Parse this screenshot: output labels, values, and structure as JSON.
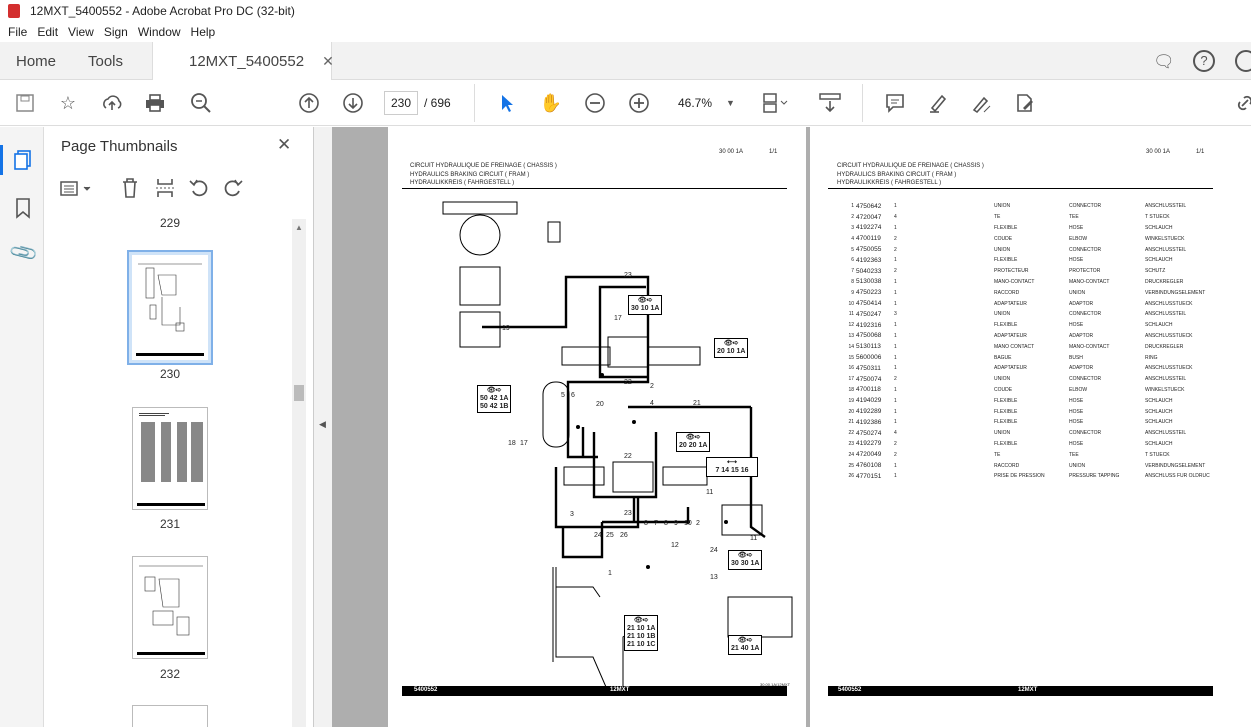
{
  "window": {
    "title": "12MXT_5400552 - Adobe Acrobat Pro DC (32-bit)"
  },
  "menu": [
    "File",
    "Edit",
    "View",
    "Sign",
    "Window",
    "Help"
  ],
  "tabs": {
    "home": "Home",
    "tools": "Tools",
    "document": "12MXT_5400552"
  },
  "toolbar": {
    "page_current": "230",
    "page_total": "/ 696",
    "zoom": "46.7%"
  },
  "sidebar": {
    "title": "Page Thumbnails",
    "thumbnails": [
      "229",
      "230",
      "231",
      "232"
    ]
  },
  "left_page": {
    "title_lines": [
      "CIRCUIT HYDRAULIQUE DE FREINAGE ( CHASSIS )",
      "HYDRAULICS BRAKING CIRCUIT ( FRAM )",
      "HYDRAULIKKREIS ( FAHRGESTELL )"
    ],
    "ref": "30  00  1A",
    "pageno": "1/1",
    "footer_left": "5400552",
    "footer_center": "12MXT",
    "drawing_code": "30.00.1A/12MXT",
    "refs": {
      "r1": "30 10 1A",
      "r2": "20 10 1A",
      "r3a": "50 42 1A",
      "r3b": "50 42 1B",
      "r4": "20 20 1A",
      "r5": "7  14 15 16",
      "r6": "30 30 1A",
      "r7a": "21 10 1A",
      "r7b": "21 10 1B",
      "r7c": "21 10 1C",
      "r8": "21 40 1A"
    },
    "callouts": [
      "23",
      "17",
      "19",
      "22",
      "2",
      "18",
      "17",
      "5",
      "4",
      "6",
      "20",
      "21",
      "22",
      "23",
      "3",
      "24",
      "25",
      "26",
      "1",
      "8",
      "7",
      "8",
      "9",
      "10",
      "2",
      "11",
      "12",
      "24",
      "13",
      "11"
    ]
  },
  "right_page": {
    "title_lines": [
      "CIRCUIT HYDRAULIQUE DE FREINAGE ( CHASSIS )",
      "HYDRAULICS BRAKING CIRCUIT ( FRAM )",
      "HYDRAULIKKREIS ( FAHRGESTELL )"
    ],
    "ref": "30  00  1A",
    "pageno": "1/1",
    "footer_left": "5400552",
    "footer_center": "12MXT",
    "parts": [
      [
        "1",
        "4750642",
        "1",
        "UNION",
        "CONNECTOR",
        "ANSCHLUSSTEIL"
      ],
      [
        "2",
        "4720047",
        "4",
        "TE",
        "TEE",
        "T STUECK"
      ],
      [
        "3",
        "4192274",
        "1",
        "FLEXIBLE",
        "HOSE",
        "SCHLAUCH"
      ],
      [
        "4",
        "4700119",
        "2",
        "COUDE",
        "ELBOW",
        "WINKELSTUECK"
      ],
      [
        "5",
        "4750055",
        "2",
        "UNION",
        "CONNECTOR",
        "ANSCHLUSSTEIL"
      ],
      [
        "6",
        "4192363",
        "1",
        "FLEXIBLE",
        "HOSE",
        "SCHLAUCH"
      ],
      [
        "7",
        "5040233",
        "2",
        "PROTECTEUR",
        "PROTECTOR",
        "SCHUTZ"
      ],
      [
        "8",
        "5130038",
        "1",
        "MANO-CONTACT",
        "MANO-CONTACT",
        "DRUCKREGLER"
      ],
      [
        "9",
        "4750223",
        "1",
        "RACCORD",
        "UNION",
        "VERBINDUNGSELEMENT"
      ],
      [
        "10",
        "4750414",
        "1",
        "ADAPTATEUR",
        "ADAPTOR",
        "ANSCHLUSSTUECK"
      ],
      [
        "11",
        "4750247",
        "3",
        "UNION",
        "CONNECTOR",
        "ANSCHLUSSTEIL"
      ],
      [
        "12",
        "4192316",
        "1",
        "FLEXIBLE",
        "HOSE",
        "SCHLAUCH"
      ],
      [
        "13",
        "4750068",
        "1",
        "ADAPTATEUR",
        "ADAPTOR",
        "ANSCHLUSSTUECK"
      ],
      [
        "14",
        "5130113",
        "1",
        "MANO CONTACT",
        "MANO-CONTACT",
        "DRUCKREGLER"
      ],
      [
        "15",
        "5600006",
        "1",
        "BAGUE",
        "BUSH",
        "RING"
      ],
      [
        "16",
        "4750311",
        "1",
        "ADAPTATEUR",
        "ADAPTOR",
        "ANSCHLUSSTUECK"
      ],
      [
        "17",
        "4750074",
        "2",
        "UNION",
        "CONNECTOR",
        "ANSCHLUSSTEIL"
      ],
      [
        "18",
        "4700118",
        "1",
        "COUDE",
        "ELBOW",
        "WINKELSTUECK"
      ],
      [
        "19",
        "4194029",
        "1",
        "FLEXIBLE",
        "HOSE",
        "SCHLAUCH"
      ],
      [
        "20",
        "4192289",
        "1",
        "FLEXIBLE",
        "HOSE",
        "SCHLAUCH"
      ],
      [
        "21",
        "4192386",
        "1",
        "FLEXIBLE",
        "HOSE",
        "SCHLAUCH"
      ],
      [
        "22",
        "4750274",
        "4",
        "UNION",
        "CONNECTOR",
        "ANSCHLUSSTEIL"
      ],
      [
        "23",
        "4192279",
        "2",
        "FLEXIBLE",
        "HOSE",
        "SCHLAUCH"
      ],
      [
        "24",
        "4720049",
        "2",
        "TE",
        "TEE",
        "T STUECK"
      ],
      [
        "25",
        "4760108",
        "1",
        "RACCORD",
        "UNION",
        "VERBINDUNGSELEMENT"
      ],
      [
        "26",
        "4770151",
        "1",
        "PRISE DE PRESSION",
        "PRESSURE TAPPING",
        "ANSCHLUSS FUR OLDRUC"
      ]
    ]
  }
}
